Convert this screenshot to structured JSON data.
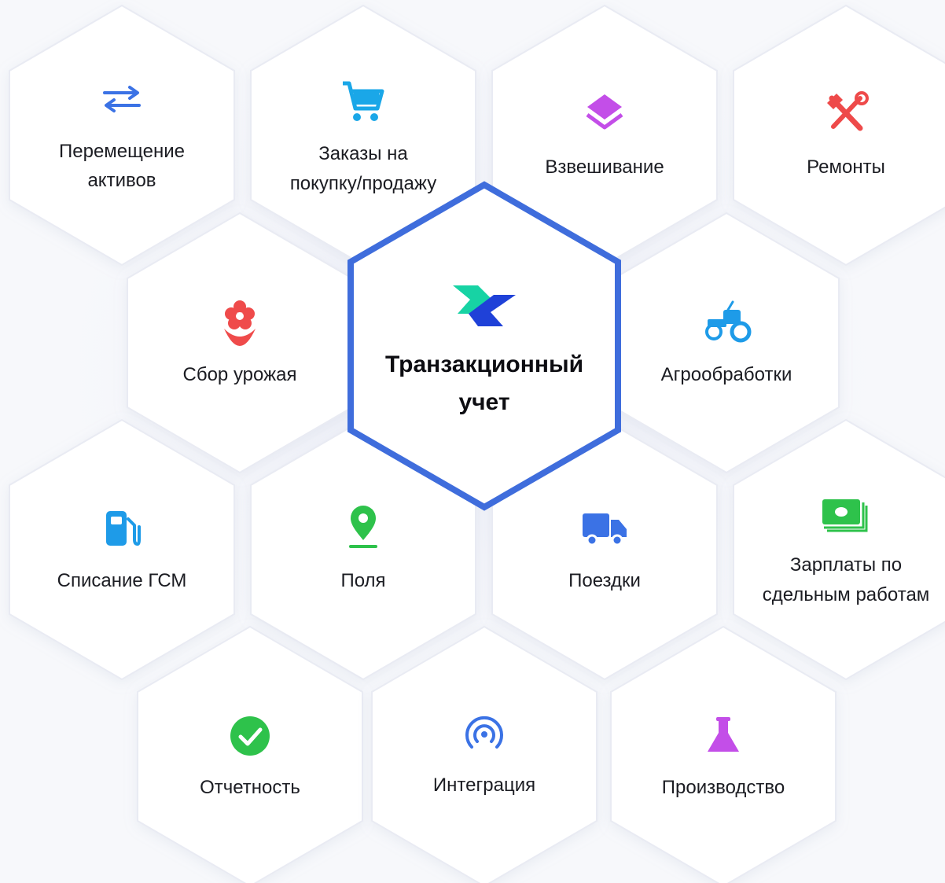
{
  "center": {
    "title_line1": "Транзакционный",
    "title_line2": "учет",
    "logo": "logo-double-chevron",
    "border_color": "#3f6ddc",
    "logo_colors": [
      "#17d3a4",
      "#1f41d8"
    ]
  },
  "modules": [
    {
      "id": "asset-transfer",
      "icon": "transfer-arrows-icon",
      "color": "#3b72e5",
      "line1": "Перемещение",
      "line2": "активов"
    },
    {
      "id": "purchase-orders",
      "icon": "shopping-cart-icon",
      "color": "#1aa7e8",
      "line1": "Заказы на",
      "line2": "покупку/продажу"
    },
    {
      "id": "weighing",
      "icon": "layers-icon",
      "color": "#c34ee8",
      "line1": "Взвешивание",
      "line2": ""
    },
    {
      "id": "repairs",
      "icon": "tools-icon",
      "color": "#ee4a4a",
      "line1": "Ремонты",
      "line2": ""
    },
    {
      "id": "harvest",
      "icon": "flower-icon",
      "color": "#ef4b4b",
      "line1": "Сбор урожая",
      "line2": ""
    },
    {
      "id": "agro-operations",
      "icon": "tractor-icon",
      "color": "#1e9be8",
      "line1": "Агрообработки",
      "line2": ""
    },
    {
      "id": "fuel-writeoff",
      "icon": "fuel-pump-icon",
      "color": "#1e9be8",
      "line1": "Списание ГСМ",
      "line2": ""
    },
    {
      "id": "fields",
      "icon": "map-pin-icon",
      "color": "#2ec24b",
      "line1": "Поля",
      "line2": ""
    },
    {
      "id": "trips",
      "icon": "truck-icon",
      "color": "#3b72e5",
      "line1": "Поездки",
      "line2": ""
    },
    {
      "id": "piecework-salary",
      "icon": "money-icon",
      "color": "#2ec24b",
      "line1": "Зарплаты по",
      "line2": "сдельным работам"
    },
    {
      "id": "reports",
      "icon": "check-circle-icon",
      "color": "#2ec24b",
      "line1": "Отчетность",
      "line2": ""
    },
    {
      "id": "integration",
      "icon": "signal-icon",
      "color": "#3b72e5",
      "line1": "Интеграция",
      "line2": ""
    },
    {
      "id": "production",
      "icon": "flask-icon",
      "color": "#c34ee8",
      "line1": "Производство",
      "line2": ""
    }
  ]
}
